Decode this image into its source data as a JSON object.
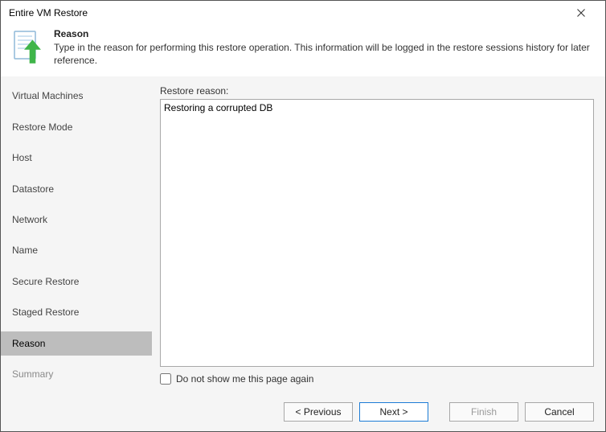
{
  "window": {
    "title": "Entire VM Restore"
  },
  "header": {
    "heading": "Reason",
    "description": "Type in the reason for performing this restore operation. This information will be logged in the restore sessions history for later reference."
  },
  "sidebar": {
    "items": [
      {
        "label": "Virtual Machines",
        "active": false
      },
      {
        "label": "Restore Mode",
        "active": false
      },
      {
        "label": "Host",
        "active": false
      },
      {
        "label": "Datastore",
        "active": false
      },
      {
        "label": "Network",
        "active": false
      },
      {
        "label": "Name",
        "active": false
      },
      {
        "label": "Secure Restore",
        "active": false
      },
      {
        "label": "Staged Restore",
        "active": false
      },
      {
        "label": "Reason",
        "active": true
      },
      {
        "label": "Summary",
        "active": false,
        "subtle": true
      }
    ]
  },
  "content": {
    "reason_label": "Restore reason:",
    "reason_value": "Restoring a corrupted DB",
    "checkbox_label": "Do not show me this page again",
    "checkbox_checked": false
  },
  "footer": {
    "previous_label": "< Previous",
    "next_label": "Next >",
    "finish_label": "Finish",
    "cancel_label": "Cancel",
    "finish_enabled": false
  }
}
